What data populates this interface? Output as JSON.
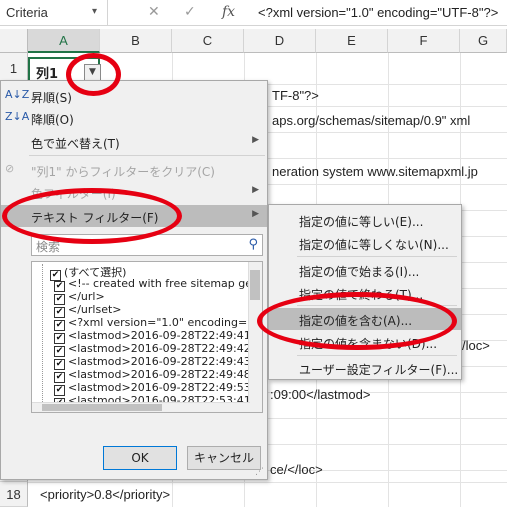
{
  "formula_bar": {
    "name_box": "Criteria",
    "cancel_icon": "✕",
    "enter_icon": "✓",
    "fx_label": "fx",
    "formula": "<?xml version=\"1.0\" encoding=\"UTF-8\"?>"
  },
  "columns": [
    "A",
    "B",
    "C",
    "D",
    "E",
    "F",
    "G"
  ],
  "rows": [
    "1",
    "18"
  ],
  "cells": {
    "a1": "列1",
    "d2": "TF-8\"?>",
    "d3": "aps.org/schemas/sitemap/0.9\" xml",
    "d5": "neration system www.sitemapxml.jp",
    "e12": "/loc>",
    "d14": ":09:00</lastmod>",
    "d17": "ce/</loc>",
    "a18": "<priority>0.8</priority>"
  },
  "filter_menu": {
    "items": [
      {
        "icon": "sort-asc-icon",
        "glyph": "A↓Z",
        "label": "昇順(S)"
      },
      {
        "icon": "sort-desc-icon",
        "glyph": "Z↓A",
        "label": "降順(O)"
      },
      {
        "icon": "",
        "glyph": "",
        "label": "色で並べ替え(T)"
      },
      {
        "icon": "clear-filter-icon",
        "glyph": "⊘",
        "label": "\"列1\" からフィルターをクリア(C)"
      },
      {
        "icon": "",
        "glyph": "",
        "label": "色フィルター(I)"
      },
      {
        "icon": "",
        "glyph": "",
        "label": "テキスト フィルター(F)"
      }
    ],
    "search_placeholder": "検索",
    "list_items": [
      "(すべて選択)",
      "<!-- created with free sitemap ge",
      "</url>",
      "</urlset>",
      "<?xml version=\"1.0\" encoding=\"UT",
      "<lastmod>2016-09-28T22:49:41+0",
      "<lastmod>2016-09-28T22:49:42+0",
      "<lastmod>2016-09-28T22:49:43+0",
      "<lastmod>2016-09-28T22:49:48+0",
      "<lastmod>2016-09-28T22:49:53+0",
      "<lastmod>2016-09-28T22:53:41+0"
    ],
    "ok_label": "OK",
    "cancel_label": "キャンセル"
  },
  "text_filter_submenu": {
    "items": [
      "指定の値に等しい(E)...",
      "指定の値に等しくない(N)...",
      "指定の値で始まる(I)...",
      "指定の値で終わる(T)...",
      "指定の値を含む(A)...",
      "指定の値を含まない(D)...",
      "ユーザー設定フィルター(F)..."
    ]
  },
  "colors": {
    "annotation": "#e60012",
    "excel_green": "#217346",
    "menu_bg": "#f0f0f0",
    "highlight": "#bcbcbc"
  }
}
